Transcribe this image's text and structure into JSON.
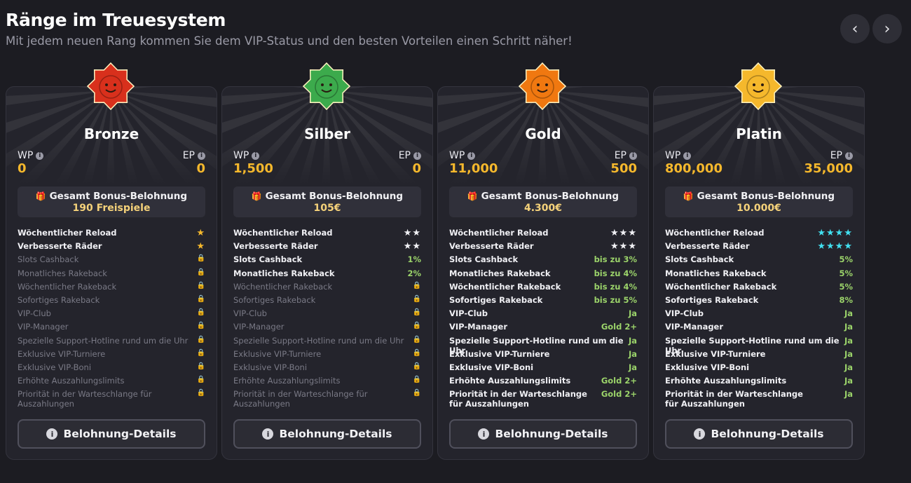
{
  "header": {
    "title": "Ränge im Treuesystem",
    "subtitle": "Mit jedem neuen Rang kommen Sie dem VIP-Status und den besten Vorteilen einen Schritt näher!"
  },
  "nav": {
    "prev_icon": "chevron-left-icon",
    "prev_glyph": "‹",
    "next_icon": "chevron-right-icon",
    "next_glyph": "›"
  },
  "labels": {
    "wp": "WP",
    "ep": "EP",
    "info_glyph": "i",
    "bonus_title": "Gesamt Bonus-Belohnung",
    "details_button": "Belohnung-Details"
  },
  "colors": {
    "accent": "#f5b82c",
    "positive": "#9bd36a",
    "star_cyan": "#42e0f0",
    "gem_bronze": "#d8301c",
    "gem_silver": "#3caa4c",
    "gem_gold": "#f07810",
    "gem_platin": "#f5b82c"
  },
  "ranks": [
    {
      "name": "Bronze",
      "wp": "0",
      "ep": "0",
      "bonus": "190 Freispiele",
      "features": [
        {
          "label": "Wöchentlicher Reload",
          "value": "★"
        },
        {
          "label": "Verbesserte Räder",
          "value": "★"
        },
        {
          "label": "Slots Cashback",
          "value": "🔒"
        },
        {
          "label": "Monatliches Rakeback",
          "value": "🔒"
        },
        {
          "label": "Wöchentlicher Rakeback",
          "value": "🔒"
        },
        {
          "label": "Sofortiges Rakeback",
          "value": "🔒"
        },
        {
          "label": "VIP-Club",
          "value": "🔒"
        },
        {
          "label": "VIP-Manager",
          "value": "🔒"
        },
        {
          "label": "Spezielle Support-Hotline rund um die Uhr",
          "value": "🔒"
        },
        {
          "label": "Exklusive VIP-Turniere",
          "value": "🔒"
        },
        {
          "label": "Exklusive VIP-Boni",
          "value": "🔒"
        },
        {
          "label": "Erhöhte Auszahlungslimits",
          "value": "🔒"
        },
        {
          "label": "Priorität in der Warteschlange für Auszahlungen",
          "value": "🔒"
        }
      ]
    },
    {
      "name": "Silber",
      "wp": "1,500",
      "ep": "0",
      "bonus": "105€",
      "features": [
        {
          "label": "Wöchentlicher Reload",
          "value": "★★"
        },
        {
          "label": "Verbesserte Räder",
          "value": "★★"
        },
        {
          "label": "Slots Cashback",
          "value": "1%"
        },
        {
          "label": "Monatliches Rakeback",
          "value": "2%"
        },
        {
          "label": "Wöchentlicher Rakeback",
          "value": "🔒"
        },
        {
          "label": "Sofortiges Rakeback",
          "value": "🔒"
        },
        {
          "label": "VIP-Club",
          "value": "🔒"
        },
        {
          "label": "VIP-Manager",
          "value": "🔒"
        },
        {
          "label": "Spezielle Support-Hotline rund um die Uhr",
          "value": "🔒"
        },
        {
          "label": "Exklusive VIP-Turniere",
          "value": "🔒"
        },
        {
          "label": "Exklusive VIP-Boni",
          "value": "🔒"
        },
        {
          "label": "Erhöhte Auszahlungslimits",
          "value": "🔒"
        },
        {
          "label": "Priorität in der Warteschlange für Auszahlungen",
          "value": "🔒"
        }
      ]
    },
    {
      "name": "Gold",
      "wp": "11,000",
      "ep": "500",
      "bonus": "4.300€",
      "features": [
        {
          "label": "Wöchentlicher Reload",
          "value": "★★★"
        },
        {
          "label": "Verbesserte Räder",
          "value": "★★★"
        },
        {
          "label": "Slots Cashback",
          "value": "bis zu 3%"
        },
        {
          "label": "Monatliches Rakeback",
          "value": "bis zu 4%"
        },
        {
          "label": "Wöchentlicher Rakeback",
          "value": "bis zu 4%"
        },
        {
          "label": "Sofortiges Rakeback",
          "value": "bis zu 5%"
        },
        {
          "label": "VIP-Club",
          "value": "Ja"
        },
        {
          "label": "VIP-Manager",
          "value": "Gold 2+"
        },
        {
          "label": "Spezielle Support-Hotline rund um die Uhr",
          "value": "Ja"
        },
        {
          "label": "Exklusive VIP-Turniere",
          "value": "Ja"
        },
        {
          "label": "Exklusive VIP-Boni",
          "value": "Ja"
        },
        {
          "label": "Erhöhte Auszahlungslimits",
          "value": "Gold 2+"
        },
        {
          "label": "Priorität in der Warteschlange für Auszahlungen",
          "value": "Gold 2+"
        }
      ]
    },
    {
      "name": "Platin",
      "wp": "800,000",
      "ep": "35,000",
      "bonus": "10.000€",
      "features": [
        {
          "label": "Wöchentlicher Reload",
          "value": "★★★★"
        },
        {
          "label": "Verbesserte Räder",
          "value": "★★★★"
        },
        {
          "label": "Slots Cashback",
          "value": "5%"
        },
        {
          "label": "Monatliches Rakeback",
          "value": "5%"
        },
        {
          "label": "Wöchentlicher Rakeback",
          "value": "5%"
        },
        {
          "label": "Sofortiges Rakeback",
          "value": "8%"
        },
        {
          "label": "VIP-Club",
          "value": "Ja"
        },
        {
          "label": "VIP-Manager",
          "value": "Ja"
        },
        {
          "label": "Spezielle Support-Hotline rund um die Uhr",
          "value": "Ja"
        },
        {
          "label": "Exklusive VIP-Turniere",
          "value": "Ja"
        },
        {
          "label": "Exklusive VIP-Boni",
          "value": "Ja"
        },
        {
          "label": "Erhöhte Auszahlungslimits",
          "value": "Ja"
        },
        {
          "label": "Priorität in der Warteschlange für Auszahlungen",
          "value": "Ja"
        }
      ]
    }
  ]
}
